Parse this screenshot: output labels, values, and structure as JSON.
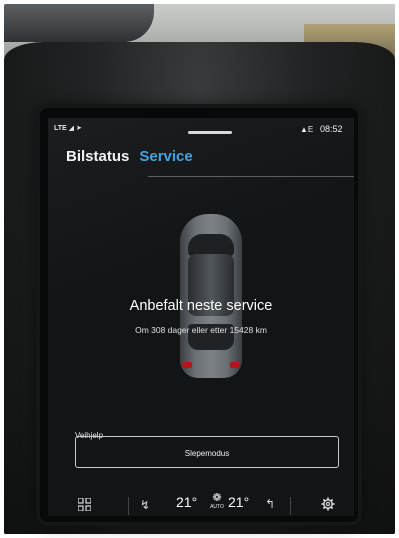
{
  "status_bar": {
    "signal": "LTE",
    "clock": "08:52"
  },
  "tabs": [
    {
      "label": "Bilstatus"
    },
    {
      "label": "Service"
    }
  ],
  "service": {
    "title": "Anbefalt neste service",
    "subtitle": "Om 308 dager eller etter 15428 km"
  },
  "towing": {
    "section_label": "Veihjelp",
    "button_label": "Slepemodus"
  },
  "climate": {
    "temp_left": "21°",
    "temp_right": "21°",
    "fan_mode": "AUTO"
  },
  "colors": {
    "accent": "#3aa2e2",
    "screen_bg": "#121416"
  }
}
